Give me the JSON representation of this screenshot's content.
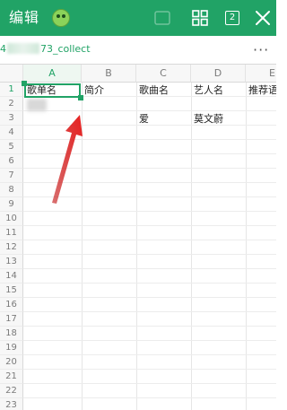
{
  "topbar": {
    "edit_label": "编辑",
    "tabs_count": "2"
  },
  "file": {
    "name_prefix": "4",
    "name_suffix": "73_collect",
    "more_label": "···"
  },
  "columns": [
    "A",
    "B",
    "C",
    "D",
    "E"
  ],
  "rows": [
    "1",
    "2",
    "3",
    "4",
    "5",
    "6",
    "7",
    "8",
    "9",
    "10",
    "11",
    "12",
    "13",
    "14",
    "15",
    "16",
    "17",
    "18",
    "19",
    "20",
    "21",
    "22",
    "23"
  ],
  "cells": {
    "a1": "歌单名",
    "b1": "简介",
    "c1": "歌曲名",
    "d1": "艺人名",
    "e1": "推荐语",
    "c3": "爱",
    "d3": "莫文蔚"
  },
  "colors": {
    "accent": "#21a366",
    "arrow": "#e02020"
  }
}
